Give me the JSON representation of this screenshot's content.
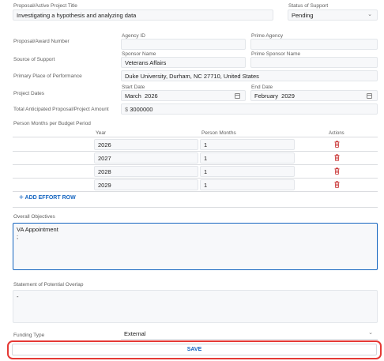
{
  "project": {
    "title_label": "Proposal/Active Project Title",
    "title_value": "Investigating a hypothesis and analyzing data",
    "status_label": "Status of Support",
    "status_value": "Pending"
  },
  "award": {
    "label": "Proposal/Award Number",
    "agency_id_label": "Agency ID",
    "prime_agency_label": "Prime Agency"
  },
  "support": {
    "label": "Source of Support",
    "sponsor_name_label": "Sponsor Name",
    "sponsor_name_value": "Veterans Affairs",
    "prime_sponsor_label": "Prime Sponsor Name"
  },
  "place": {
    "label": "Primary Place of Performance",
    "value": "Duke University, Durham, NC 27710, United States"
  },
  "dates": {
    "label": "Project Dates",
    "start_label": "Start Date",
    "start_value": "March  2026",
    "end_label": "End Date",
    "end_value": "February  2029"
  },
  "amount": {
    "label": "Total Anticipated Proposal/Project Amount",
    "currency": "$",
    "value": "3000000"
  },
  "person_months": {
    "label": "Person Months per Budget Period",
    "col_year": "Year",
    "col_months": "Person Months",
    "col_actions": "Actions",
    "rows": [
      {
        "year": "2026",
        "months": "1"
      },
      {
        "year": "2027",
        "months": "1"
      },
      {
        "year": "2028",
        "months": "1"
      },
      {
        "year": "2029",
        "months": "1"
      }
    ],
    "add_label": "ADD EFFORT ROW"
  },
  "objectives": {
    "label": "Overall Objectives",
    "value": "VA Appointment\n;"
  },
  "overlap": {
    "label": "Statement of Potential Overlap",
    "value": "-"
  },
  "funding": {
    "label": "Funding Type",
    "value": "External"
  },
  "save_label": "SAVE",
  "colors": {
    "accent": "#1565c0",
    "danger": "#c62828",
    "highlight": "#e53935",
    "field_bg": "#f7f8fa"
  }
}
